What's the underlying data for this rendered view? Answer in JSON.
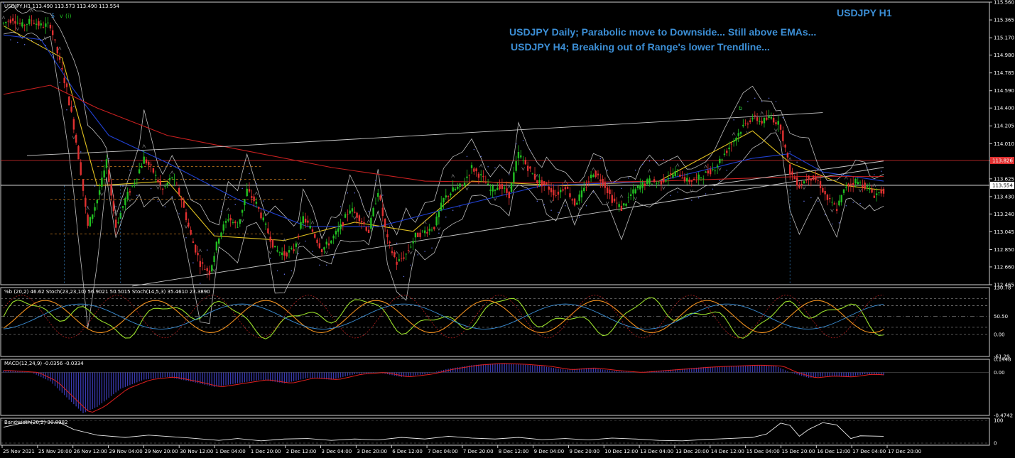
{
  "chart_data": [
    {
      "type": "candlestick",
      "title": "USDJPY H1",
      "header": "USDJPY,H1  113.490 113.573 113.490 113.554",
      "wave_labels": [
        "5",
        "v",
        "(i)",
        "b"
      ],
      "annotations": [
        "USDJPY Daily; Parabolic move to Downside... Still above EMAs...",
        "USDJPY H4; Breaking out of Range's lower Trendline..."
      ],
      "y_ticks": [
        115.56,
        115.365,
        115.17,
        114.98,
        114.785,
        114.59,
        114.4,
        114.205,
        114.01,
        113.825,
        113.625,
        113.43,
        113.24,
        113.045,
        112.85,
        112.66,
        112.465
      ],
      "ylim": [
        112.465,
        115.56
      ],
      "price_markers": [
        {
          "label": "113.826",
          "value": 113.826,
          "color": "#e03030"
        },
        {
          "label": "113.554",
          "value": 113.554,
          "color": "#ffffff"
        }
      ],
      "x_ticks": [
        "25 Nov 2021",
        "25 Nov 20:00",
        "26 Nov 12:00",
        "29 Nov 04:00",
        "29 Nov 20:00",
        "30 Nov 12:00",
        "1 Dec 04:00",
        "1 Dec 20:00",
        "2 Dec 12:00",
        "3 Dec 04:00",
        "3 Dec 20:00",
        "6 Dec 12:00",
        "7 Dec 04:00",
        "7 Dec 20:00",
        "8 Dec 12:00",
        "9 Dec 04:00",
        "9 Dec 20:00",
        "10 Dec 12:00",
        "13 Dec 04:00",
        "13 Dec 20:00",
        "14 Dec 12:00",
        "15 Dec 04:00",
        "15 Dec 20:00",
        "16 Dec 12:00",
        "17 Dec 04:00",
        "17 Dec 20:00"
      ],
      "close_path": [
        [
          0,
          115.33
        ],
        [
          4,
          115.38
        ],
        [
          8,
          115.3
        ],
        [
          12,
          115.36
        ],
        [
          16,
          115.3
        ],
        [
          20,
          115.31
        ],
        [
          24,
          114.9
        ],
        [
          27,
          114.6
        ],
        [
          30,
          114.2
        ],
        [
          33,
          113.7
        ],
        [
          36,
          113.1
        ],
        [
          40,
          113.4
        ],
        [
          44,
          113.8
        ],
        [
          48,
          113.1
        ],
        [
          52,
          113.4
        ],
        [
          56,
          113.6
        ],
        [
          60,
          113.85
        ],
        [
          64,
          113.7
        ],
        [
          68,
          113.5
        ],
        [
          72,
          113.65
        ],
        [
          76,
          113.4
        ],
        [
          80,
          113.0
        ],
        [
          84,
          112.7
        ],
        [
          88,
          112.6
        ],
        [
          92,
          113.0
        ],
        [
          96,
          113.2
        ],
        [
          100,
          113.1
        ],
        [
          104,
          113.5
        ],
        [
          108,
          113.35
        ],
        [
          112,
          113.1
        ],
        [
          116,
          112.85
        ],
        [
          120,
          112.8
        ],
        [
          124,
          112.85
        ],
        [
          128,
          113.2
        ],
        [
          132,
          113.05
        ],
        [
          136,
          112.85
        ],
        [
          140,
          112.95
        ],
        [
          144,
          113.1
        ],
        [
          148,
          113.3
        ],
        [
          152,
          113.2
        ],
        [
          156,
          113.05
        ],
        [
          160,
          113.5
        ],
        [
          164,
          112.95
        ],
        [
          168,
          112.7
        ],
        [
          172,
          112.8
        ],
        [
          176,
          113.0
        ],
        [
          180,
          113.05
        ],
        [
          184,
          113.1
        ],
        [
          188,
          113.4
        ],
        [
          192,
          113.5
        ],
        [
          196,
          113.55
        ],
        [
          200,
          113.75
        ],
        [
          204,
          113.65
        ],
        [
          208,
          113.5
        ],
        [
          212,
          113.55
        ],
        [
          216,
          113.45
        ],
        [
          220,
          113.9
        ],
        [
          224,
          113.75
        ],
        [
          228,
          113.6
        ],
        [
          232,
          113.55
        ],
        [
          236,
          113.45
        ],
        [
          240,
          113.55
        ],
        [
          244,
          113.35
        ],
        [
          248,
          113.5
        ],
        [
          252,
          113.7
        ],
        [
          256,
          113.6
        ],
        [
          260,
          113.4
        ],
        [
          264,
          113.3
        ],
        [
          268,
          113.45
        ],
        [
          272,
          113.55
        ],
        [
          276,
          113.6
        ],
        [
          280,
          113.58
        ],
        [
          284,
          113.65
        ],
        [
          288,
          113.7
        ],
        [
          292,
          113.6
        ],
        [
          296,
          113.62
        ],
        [
          300,
          113.68
        ],
        [
          304,
          113.75
        ],
        [
          308,
          113.9
        ],
        [
          312,
          114.05
        ],
        [
          316,
          114.2
        ],
        [
          320,
          114.3
        ],
        [
          324,
          114.25
        ],
        [
          328,
          114.3
        ],
        [
          332,
          114.2
        ],
        [
          336,
          113.7
        ],
        [
          340,
          113.55
        ],
        [
          344,
          113.65
        ],
        [
          348,
          113.6
        ],
        [
          352,
          113.4
        ],
        [
          356,
          113.3
        ],
        [
          360,
          113.55
        ],
        [
          364,
          113.6
        ],
        [
          368,
          113.55
        ],
        [
          372,
          113.45
        ],
        [
          376,
          113.5
        ]
      ],
      "series": [
        {
          "name": "",
          "style": "ema-fast",
          "color": "#e0c020",
          "values": [
            [
              0,
              115.3
            ],
            [
              25,
              114.95
            ],
            [
              40,
              113.55
            ],
            [
              70,
              113.6
            ],
            [
              90,
              113.0
            ],
            [
              120,
              112.95
            ],
            [
              150,
              113.15
            ],
            [
              175,
              113.05
            ],
            [
              200,
              113.6
            ],
            [
              240,
              113.55
            ],
            [
              280,
              113.6
            ],
            [
              320,
              114.15
            ],
            [
              336,
              113.8
            ],
            [
              360,
              113.55
            ],
            [
              376,
              113.5
            ]
          ]
        },
        {
          "name": "",
          "style": "ema-mid",
          "color": "#2040d0",
          "values": [
            [
              0,
              115.2
            ],
            [
              16,
              115.15
            ],
            [
              30,
              114.6
            ],
            [
              45,
              114.1
            ],
            [
              70,
              113.8
            ],
            [
              100,
              113.4
            ],
            [
              130,
              113.1
            ],
            [
              160,
              113.1
            ],
            [
              190,
              113.3
            ],
            [
              230,
              113.55
            ],
            [
              280,
              113.6
            ],
            [
              320,
              113.85
            ],
            [
              336,
              113.9
            ],
            [
              350,
              113.7
            ],
            [
              376,
              113.6
            ]
          ]
        },
        {
          "name": "",
          "style": "ema-slow",
          "color": "#c82020",
          "values": [
            [
              0,
              114.55
            ],
            [
              20,
              114.65
            ],
            [
              40,
              114.4
            ],
            [
              70,
              114.1
            ],
            [
              100,
              113.95
            ],
            [
              140,
              113.75
            ],
            [
              180,
              113.6
            ],
            [
              230,
              113.58
            ],
            [
              280,
              113.6
            ],
            [
              340,
              113.65
            ],
            [
              376,
              113.65
            ]
          ]
        },
        {
          "name": "",
          "style": "trend-upper",
          "color": "#c8c8c8",
          "values": [
            [
              10,
              113.88
            ],
            [
              95,
              113.98
            ]
          ]
        },
        {
          "name": "",
          "style": "trend-upper",
          "color": "#c8c8c8",
          "values": [
            [
              95,
              113.98
            ],
            [
              350,
              114.35
            ]
          ]
        },
        {
          "name": "",
          "style": "trend-lower",
          "color": "#c8c8c8",
          "values": [
            [
              55,
              112.45
            ],
            [
              376,
              113.75
            ]
          ]
        },
        {
          "name": "",
          "style": "trend-lower",
          "color": "#c8c8c8",
          "values": [
            [
              300,
              113.55
            ],
            [
              376,
              113.82
            ]
          ]
        }
      ]
    },
    {
      "type": "line",
      "header": "%b (20,2) 46.62  Stoch(23,23,10) 56.9021 50.5015  Stoch(14,5,3) 35.4610 23.3890",
      "y_ticks": [
        "130.78",
        "50.50",
        "0.00",
        "-61.29"
      ],
      "ylim": [
        -61.29,
        130.78
      ],
      "levels": [
        100,
        80,
        50.5,
        0,
        20
      ]
    },
    {
      "type": "bar",
      "header": "MACD(12,24,9) -0.0356 -0.0334",
      "y_ticks": [
        "0.1448",
        "0.00",
        "-0.4742"
      ],
      "ylim": [
        -0.4742,
        0.1448
      ],
      "values": [
        [
          0,
          0.02
        ],
        [
          12,
          0.0
        ],
        [
          20,
          -0.1
        ],
        [
          28,
          -0.3
        ],
        [
          34,
          -0.45
        ],
        [
          40,
          -0.38
        ],
        [
          50,
          -0.18
        ],
        [
          60,
          -0.08
        ],
        [
          70,
          -0.05
        ],
        [
          80,
          -0.1
        ],
        [
          90,
          -0.16
        ],
        [
          100,
          -0.12
        ],
        [
          110,
          -0.08
        ],
        [
          120,
          -0.12
        ],
        [
          130,
          -0.06
        ],
        [
          140,
          -0.08
        ],
        [
          150,
          -0.02
        ],
        [
          160,
          0.0
        ],
        [
          170,
          -0.05
        ],
        [
          180,
          -0.02
        ],
        [
          190,
          0.04
        ],
        [
          200,
          0.08
        ],
        [
          210,
          0.1
        ],
        [
          220,
          0.09
        ],
        [
          230,
          0.07
        ],
        [
          240,
          0.03
        ],
        [
          250,
          0.05
        ],
        [
          260,
          0.02
        ],
        [
          270,
          0.0
        ],
        [
          280,
          0.02
        ],
        [
          290,
          0.04
        ],
        [
          300,
          0.06
        ],
        [
          310,
          0.07
        ],
        [
          320,
          0.08
        ],
        [
          330,
          0.07
        ],
        [
          336,
          0.0
        ],
        [
          344,
          -0.06
        ],
        [
          352,
          -0.04
        ],
        [
          360,
          -0.05
        ],
        [
          368,
          -0.02
        ],
        [
          376,
          -0.03
        ]
      ]
    },
    {
      "type": "line",
      "header": "Bandwidth(20,2) 30.8982",
      "y_ticks": [
        "100",
        "0"
      ],
      "ylim": [
        0,
        100
      ],
      "values": [
        [
          0,
          70
        ],
        [
          8,
          88
        ],
        [
          16,
          95
        ],
        [
          24,
          90
        ],
        [
          30,
          60
        ],
        [
          40,
          35
        ],
        [
          52,
          25
        ],
        [
          62,
          35
        ],
        [
          72,
          28
        ],
        [
          80,
          22
        ],
        [
          92,
          12
        ],
        [
          100,
          20
        ],
        [
          110,
          10
        ],
        [
          120,
          18
        ],
        [
          130,
          20
        ],
        [
          140,
          12
        ],
        [
          150,
          18
        ],
        [
          160,
          14
        ],
        [
          170,
          25
        ],
        [
          180,
          18
        ],
        [
          190,
          30
        ],
        [
          200,
          22
        ],
        [
          210,
          18
        ],
        [
          220,
          25
        ],
        [
          230,
          15
        ],
        [
          240,
          20
        ],
        [
          250,
          14
        ],
        [
          260,
          22
        ],
        [
          270,
          18
        ],
        [
          280,
          12
        ],
        [
          290,
          10
        ],
        [
          300,
          16
        ],
        [
          310,
          20
        ],
        [
          320,
          25
        ],
        [
          326,
          40
        ],
        [
          332,
          88
        ],
        [
          336,
          78
        ],
        [
          340,
          30
        ],
        [
          344,
          60
        ],
        [
          350,
          90
        ],
        [
          356,
          80
        ],
        [
          362,
          20
        ],
        [
          366,
          32
        ],
        [
          376,
          30
        ]
      ]
    }
  ]
}
